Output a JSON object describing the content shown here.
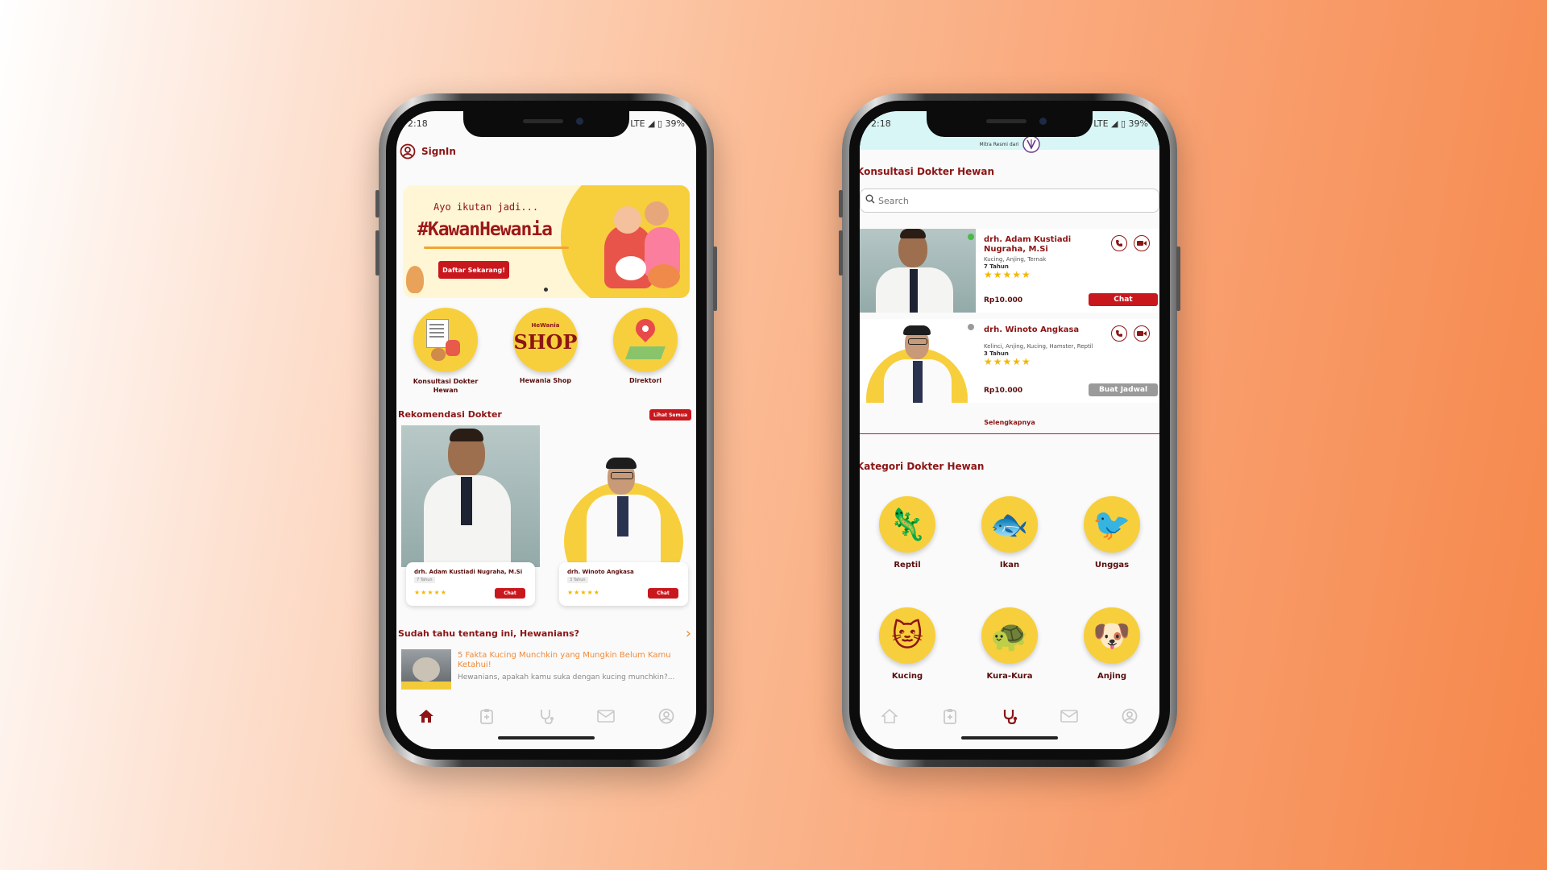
{
  "left_phone": {
    "status": {
      "time": "2:18",
      "signal": "LTE ◢ ▯ 39%"
    },
    "header": {
      "signin_label": "SignIn"
    },
    "banner": {
      "tagline": "Ayo ikutan jadi...",
      "hashtag": "#KawanHewania",
      "cta": "Daftar Sekarang!"
    },
    "menu": [
      {
        "label": "Konsultasi Dokter Hewan",
        "icon": "consultation-icon"
      },
      {
        "label": "Hewania Shop",
        "icon": "shop-icon"
      },
      {
        "label": "Direktori",
        "icon": "map-pin-icon"
      }
    ],
    "shop_logo_small": "HeWania",
    "shop_logo_big": "SHOP",
    "recommend": {
      "title": "Rekomendasi Dokter",
      "see_all": "Lihat Semua",
      "doctors": [
        {
          "name": "drh. Adam Kustiadi Nugraha, M.Si",
          "exp": "7 Tahun",
          "stars": "★★★★★",
          "chat": "Chat"
        },
        {
          "name": "drh. Winoto Angkasa",
          "exp": "3 Tahun",
          "stars": "★★★★★",
          "chat": "Chat"
        }
      ]
    },
    "articles": {
      "title": "Sudah tahu tentang ini, Hewanians?",
      "item": {
        "title": "5 Fakta Kucing Munchkin yang Mungkin Belum Kamu Ketahui!",
        "snippet": "Hewanians, apakah kamu suka dengan kucing munchkin?..."
      }
    }
  },
  "right_phone": {
    "status": {
      "time": "2:18",
      "signal": "LTE ◢ ▯ 39%"
    },
    "partner_text": "Mitra Resmi dari",
    "title": "Konsultasi Dokter Hewan",
    "search_placeholder": "Search",
    "doctors": [
      {
        "name": "drh. Adam Kustiadi Nugraha, M.Si",
        "specialty": "Kucing, Anjing, Ternak",
        "exp": "7 Tahun",
        "stars": "★★★★★",
        "price": "Rp10.000",
        "action": "Chat",
        "online": true
      },
      {
        "name": "drh. Winoto Angkasa",
        "specialty": "Kelinci, Anjing, Kucing, Hamster, Reptil",
        "exp": "3 Tahun",
        "stars": "★★★★★",
        "price": "Rp10.000",
        "action": "Buat Jadwal",
        "online": false
      }
    ],
    "more_label": "Selengkapnya",
    "category_title": "Kategori Dokter Hewan",
    "categories": [
      {
        "label": "Reptil",
        "icon": "lizard-icon"
      },
      {
        "label": "Ikan",
        "icon": "fish-icon"
      },
      {
        "label": "Unggas",
        "icon": "bird-icon"
      },
      {
        "label": "Kucing",
        "icon": "cat-icon"
      },
      {
        "label": "Kura-Kura",
        "icon": "turtle-icon"
      },
      {
        "label": "Anjing",
        "icon": "dog-icon"
      }
    ]
  },
  "colors": {
    "maroon": "#8c1515",
    "red": "#c8181e",
    "yellow": "#f7cf3d",
    "mint": "#d9f6f6"
  }
}
